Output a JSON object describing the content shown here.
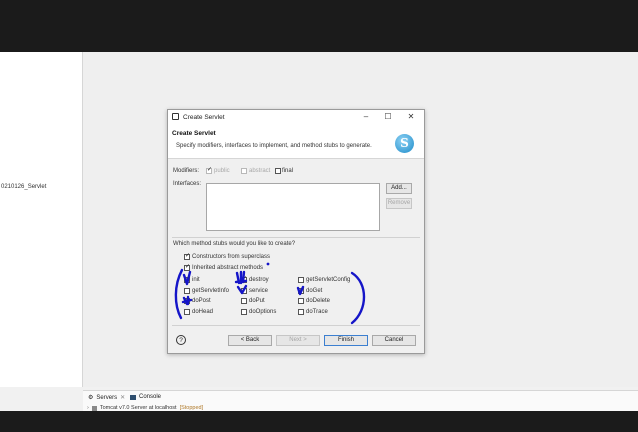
{
  "project": {
    "item_label": "0210126_Servlet"
  },
  "dialog": {
    "window_title": "Create Servlet",
    "heading": "Create Servlet",
    "description": "Specify modifiers, interfaces to implement, and method stubs to generate.",
    "modifiers_label": "Modifiers:",
    "modifiers": [
      {
        "label": "public",
        "checked": true,
        "enabled": false
      },
      {
        "label": "abstract",
        "checked": false,
        "enabled": false
      },
      {
        "label": "final",
        "checked": false,
        "enabled": true
      }
    ],
    "interfaces_label": "Interfaces:",
    "add_button": "Add...",
    "remove_button": "Remove",
    "stubs_question": "Which method stubs would you like to create?",
    "constructors_label": "Constructors from superclass",
    "inherited_label": "Inherited abstract methods",
    "methods": [
      {
        "label": "init",
        "checked": true
      },
      {
        "label": "destroy",
        "checked": true
      },
      {
        "label": "getServletConfig",
        "checked": false
      },
      {
        "label": "getServletInfo",
        "checked": false
      },
      {
        "label": "service",
        "checked": true
      },
      {
        "label": "doGet",
        "checked": true
      },
      {
        "label": "doPost",
        "checked": true
      },
      {
        "label": "doPut",
        "checked": false
      },
      {
        "label": "doDelete",
        "checked": false
      },
      {
        "label": "doHead",
        "checked": false
      },
      {
        "label": "doOptions",
        "checked": false
      },
      {
        "label": "doTrace",
        "checked": false
      }
    ],
    "buttons": {
      "back": "< Back",
      "next": "Next >",
      "finish": "Finish",
      "cancel": "Cancel"
    },
    "help_glyph": "?",
    "banner_icon_letter": "S"
  },
  "panel": {
    "servers_tab": "Servers",
    "console_tab": "Console",
    "server_name": "Tomcat v7.0 Server at localhost",
    "server_status": "[Stopped]"
  },
  "annotation_color": "#1515c8"
}
